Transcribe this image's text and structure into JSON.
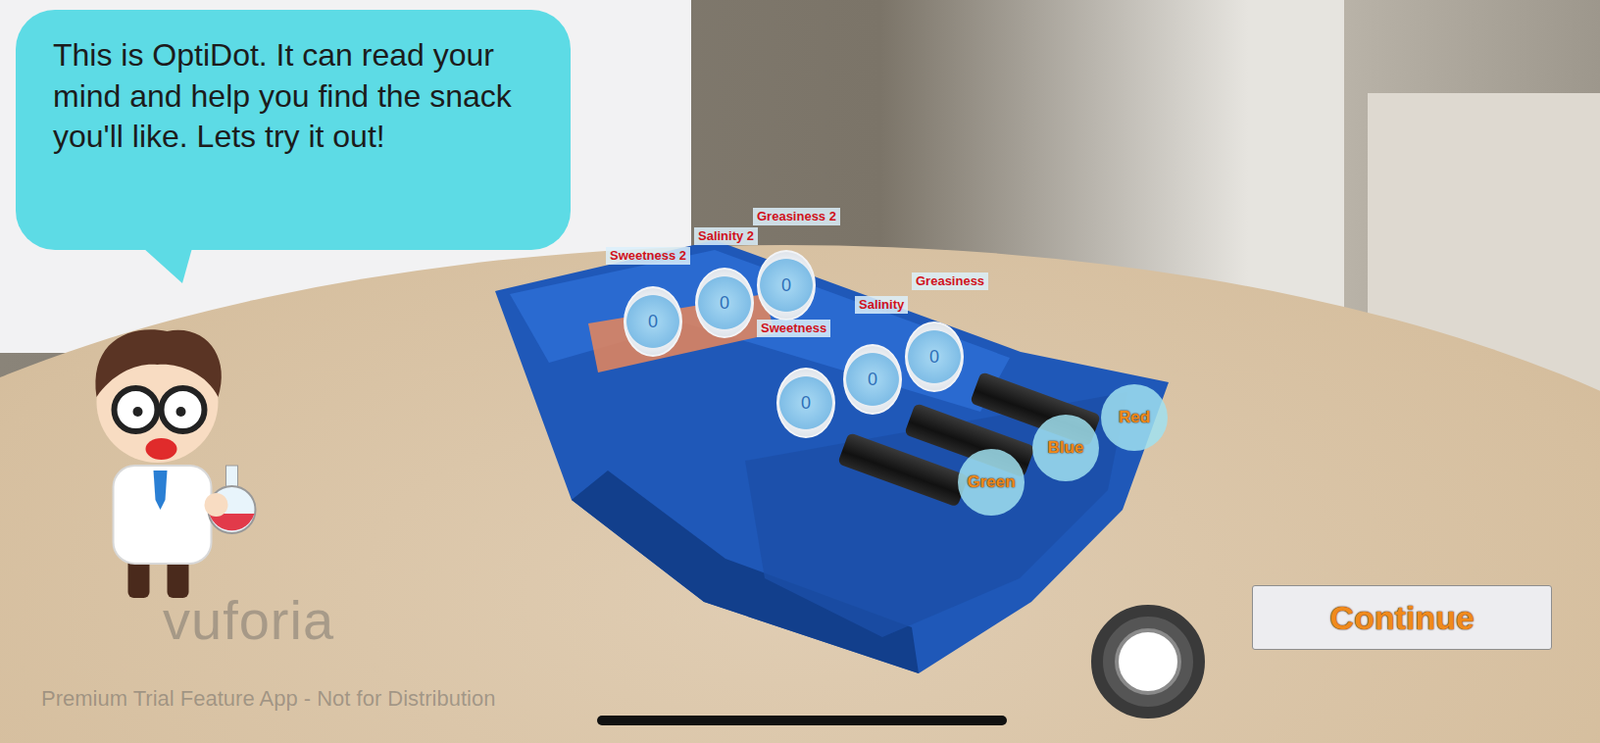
{
  "tutorial": {
    "message": "This is OptiDot. It can read your mind and help you find the snack you'll like. Lets try it out!"
  },
  "dials": [
    {
      "label": "Sweetness 2",
      "reading": "0"
    },
    {
      "label": "Salinity 2",
      "reading": "0"
    },
    {
      "label": "Greasiness 2",
      "reading": "0"
    },
    {
      "label": "Sweetness",
      "reading": "0"
    },
    {
      "label": "Salinity",
      "reading": "0"
    },
    {
      "label": "Greasiness",
      "reading": "0"
    }
  ],
  "flashlights": [
    {
      "label": "Green"
    },
    {
      "label": "Blue"
    },
    {
      "label": "Red"
    }
  ],
  "watermark": {
    "logo": "vuforia",
    "notice": "Premium Trial Feature App - Not for Distribution"
  },
  "buttons": {
    "continue": "Continue"
  }
}
